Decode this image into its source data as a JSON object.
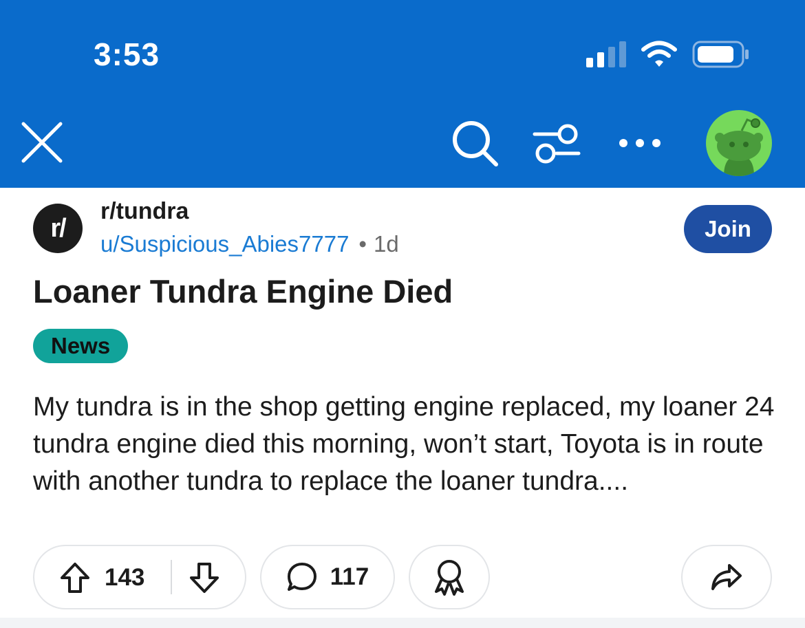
{
  "status_bar": {
    "time": "3:53"
  },
  "colors": {
    "header": "#0a6bcb",
    "join": "#1f4fa3",
    "flair": "#11a39a",
    "username": "#1a7bd3",
    "avatar": "#76d95b"
  },
  "icons": {
    "close": "close-icon",
    "search": "search-icon",
    "filter": "filter-icon",
    "more": "more-icon",
    "upvote": "upvote-icon",
    "downvote": "downvote-icon",
    "comment": "comment-icon",
    "award": "award-icon",
    "share": "share-icon"
  },
  "post": {
    "subreddit_icon_text": "r/",
    "subreddit": "r/tundra",
    "author": "u/Suspicious_Abies7777",
    "separator": "•",
    "age": "1d",
    "join_label": "Join",
    "title": "Loaner Tundra Engine Died",
    "flair": "News",
    "body": "My tundra is in the shop getting engine replaced, my loaner 24 tundra engine died this morning, won’t start, Toyota is in route with another tundra to replace the loaner tundra....",
    "upvotes": "143",
    "comments": "117"
  }
}
